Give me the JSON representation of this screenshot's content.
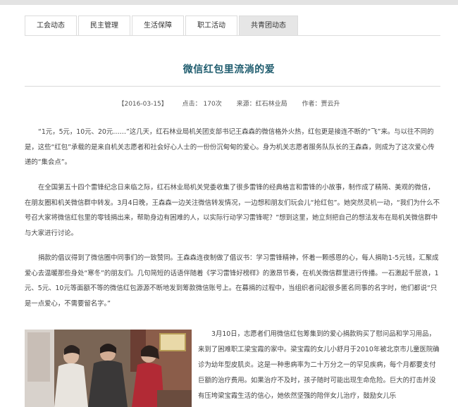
{
  "tabs": [
    {
      "label": "工会动态",
      "active": false
    },
    {
      "label": "民主管理",
      "active": false
    },
    {
      "label": "生活保障",
      "active": false
    },
    {
      "label": "职工活动",
      "active": false
    },
    {
      "label": "共青团动态",
      "active": true
    }
  ],
  "article": {
    "title": "微信红包里流淌的爱",
    "meta": {
      "date": "【2016-03-15】",
      "clicks": "点击： 170次",
      "source": "来源：红石林业局",
      "author": "作者：贾云升"
    },
    "paragraphs": [
      "“1元，5元，10元、20元……”这几天，红石林业局机关团支部书记王森森的微信格外火热，红包更是接连不断的“飞”来。与以往不同的是，这些“红包”承载的是来自机关志愿者和社会好心人士的一份份沉甸甸的爱心。身为机关志愿者服务队队长的王森森，则成为了这次爱心传递的“集会点”。",
      "在全国第五十四个雷锋纪念日来临之际，红石林业局机关党委收集了很多雷锋的经典格言和雷锋的小故事，制作成了精简、美观的微信，在朋友圈和机关微信群中转发。3月4日晚，王森森一边关注微信转发情况，一边想和朋友们玩会儿“抢红包”。她突然灵机一动，“我们为什么不号召大家将微信红包里的零钱捐出来，帮助身边有困难的人，以实际行动学习雷锋呢？”想到这里，她立刻把自己的想法发布在局机关微信群中与大家进行讨论。",
      "捐款的倡议得到了微信圈中同事们的一致赞同。王森森连夜制做了倡议书：学习雷锋精神，怀着一颗感恩的心，每人捐助1-5元钱，汇聚成爱心去温暖那些身处“寒冬”的朋友们。几句简短的话语伴随着《学习雷锋好榜样》的激昂节奏，在机关微信群里进行传播。一石激起千层浪，1元、5元、10元等面额不等的微信红包源源不断地发到筹款微信账号上。在募捐的过程中，当组织者问起很多匿名同事的名字时，他们都说“只是一点爱心，不需要留名字。”",
      "3月10日，志愿者们用微信红包筹集到的爱心捐款购买了慰问品和学习用品，来到了困难职工梁宝霞的家中。梁宝霞的女儿小舒月于2010年被北京市儿童医院确诊为幼年型皮肌炎。这是一种患病率为二十万分之一的罕见疾病，每个月都要支付巨额的治疗费用。如果治疗不及时，孩子随时可能出现生命危险。巨大的打击并没有压垮梁宝霞生活的信心，她依然坚强的陪伴女儿治疗，鼓励女儿乐"
    ]
  },
  "photo": {
    "icon": "photo-volunteers-visit"
  }
}
